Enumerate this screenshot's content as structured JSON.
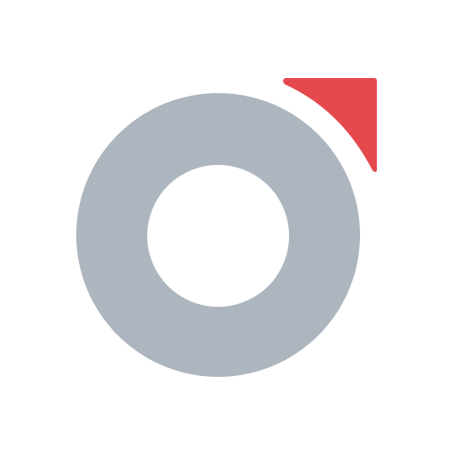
{
  "logo": {
    "icon": "ring-with-corner-arrow-icon",
    "colors": {
      "background": "#ffffff",
      "ring": "#adb5bf",
      "accent": "#e5484d"
    }
  }
}
